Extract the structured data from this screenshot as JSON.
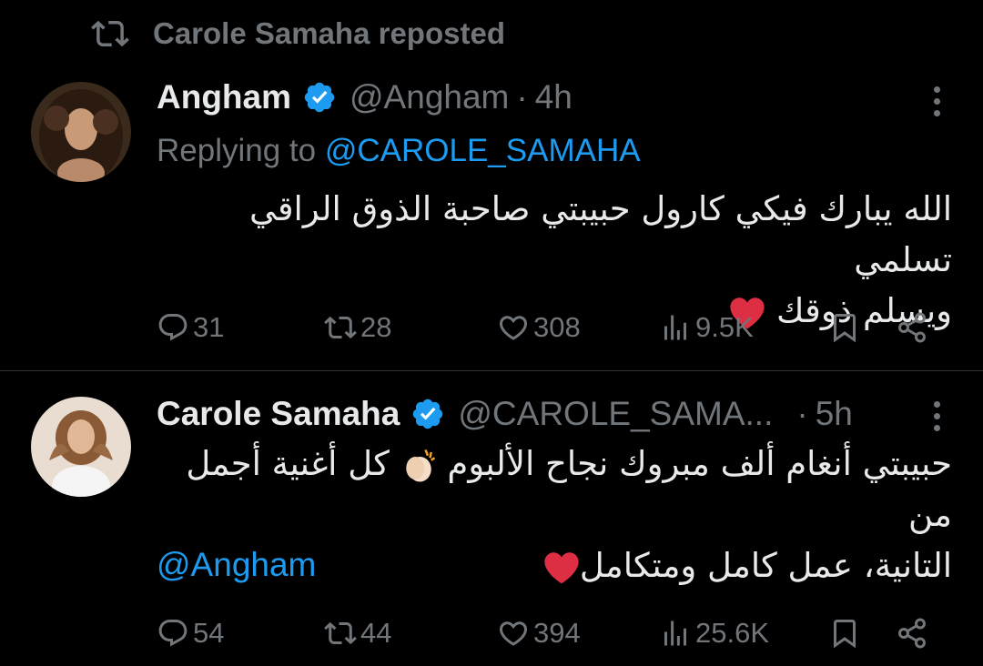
{
  "repost_banner": {
    "text": "Carole Samaha reposted"
  },
  "tweets": [
    {
      "name": "Angham",
      "handle": "@Angham",
      "separator": "·",
      "time": "4h",
      "replying_prefix": "Replying to ",
      "replying_to": "@CAROLE_SAMAHA",
      "text_line1": "الله يبارك فيكي  كارول حبيبتي صاحبة الذوق الراقي  تسلمي",
      "text_line2": "ويسلم ذوقك",
      "stats": {
        "replies": "31",
        "reposts": "28",
        "likes": "308",
        "views": "9.5K"
      }
    },
    {
      "name": "Carole Samaha",
      "handle": "@CAROLE_SAMA...",
      "separator": "·",
      "time": "5h",
      "text_line1_a": "حبيبتي أنغام ألف مبروك نجاح الألبوم",
      "text_line1_b": "كل أغنية أجمل من",
      "text_line2": "التانية، عمل كامل ومتكامل",
      "mention": "@Angham",
      "stats": {
        "replies": "54",
        "reposts": "44",
        "likes": "394",
        "views": "25.6K"
      }
    }
  ],
  "icons": {
    "repost": "repost-icon",
    "verified": "verified-badge-icon",
    "more": "more-icon",
    "reply": "reply-icon",
    "like": "heart-icon",
    "views": "views-icon",
    "bookmark": "bookmark-icon",
    "share": "share-icon"
  },
  "colors": {
    "background": "#000000",
    "text": "#e7e9ea",
    "muted": "#71767b",
    "accent": "#1d9bf0",
    "heart": "#e0245e"
  }
}
